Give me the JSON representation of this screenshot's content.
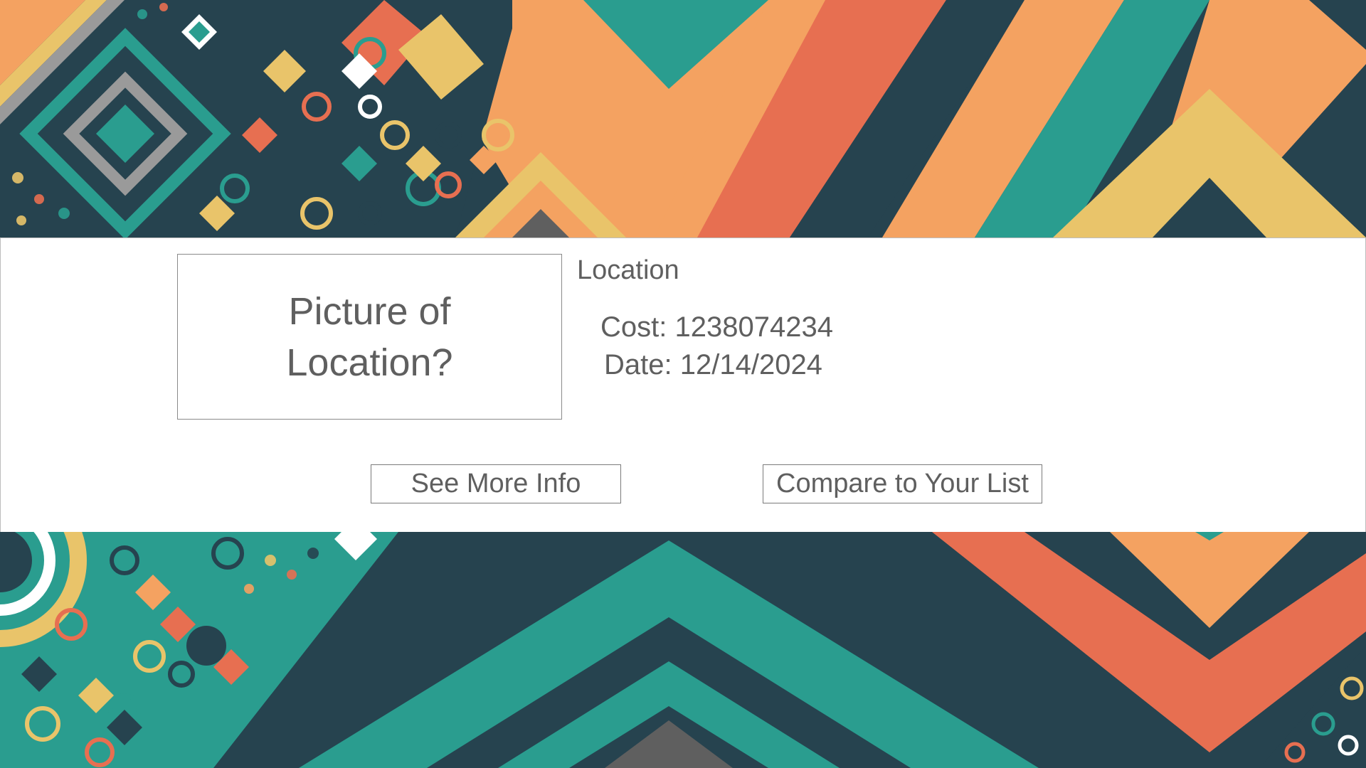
{
  "card": {
    "picture_placeholder": "Picture of Location?",
    "location_title": "Location",
    "cost_label": "Cost:",
    "cost_value": "1238074234",
    "date_label": "Date:",
    "date_value": "12/14/2024"
  },
  "actions": {
    "see_more_label": "See More Info",
    "compare_label": "Compare to Your List"
  },
  "theme": {
    "navy": "#26434f",
    "teal": "#2a9d8f",
    "yellow": "#e9c46a",
    "orange": "#f4a261",
    "coral": "#e76f51",
    "gray": "#5f5f5f"
  }
}
